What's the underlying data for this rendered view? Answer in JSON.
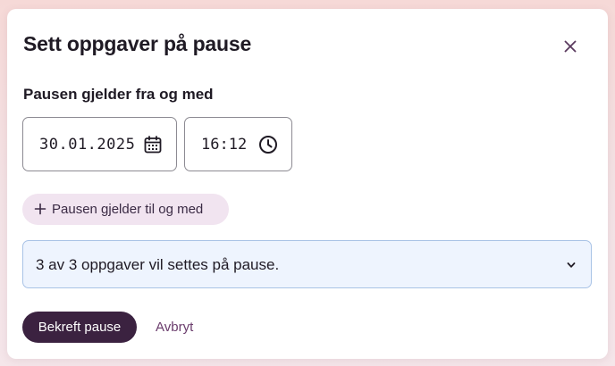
{
  "dialog": {
    "title": "Sett oppgaver på pause",
    "close_icon": "close-icon"
  },
  "pause_from": {
    "label": "Pausen gjelder fra og med",
    "date_value": "30.01.2025",
    "date_icon": "calendar-icon",
    "time_value": "16:12",
    "time_icon": "clock-icon"
  },
  "add_end": {
    "label": "Pausen gjelder til og med",
    "icon": "plus-icon"
  },
  "info": {
    "text": "3 av 3 oppgaver vil settes på pause.",
    "icon": "chevron-down-icon"
  },
  "actions": {
    "confirm_label": "Bekreft pause",
    "cancel_label": "Avbryt"
  },
  "colors": {
    "primary": "#3b2240",
    "chip_bg": "#f1e4f0",
    "info_bg": "#eef4fe",
    "info_border": "#a9c3e6",
    "link": "#6a3c6c"
  }
}
